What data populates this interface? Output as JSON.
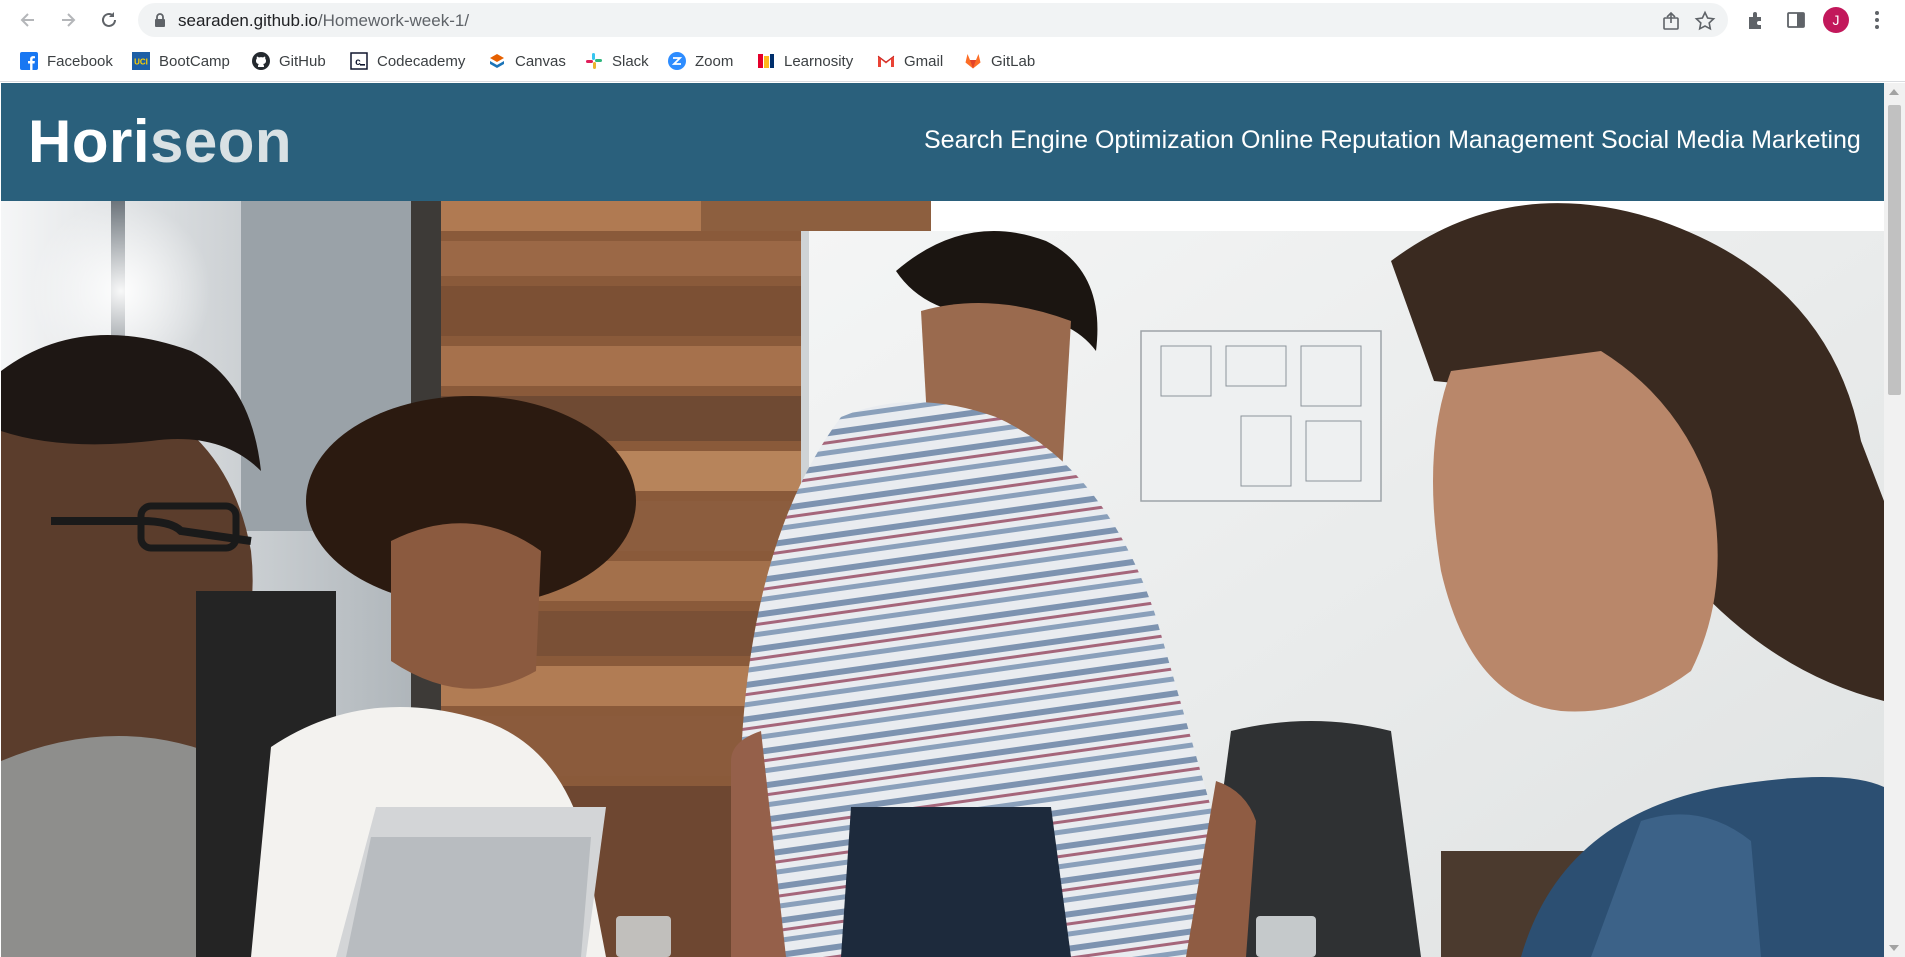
{
  "browser": {
    "url_host": "searaden.github.io",
    "url_path": "/Homework-week-1/",
    "profile_initial": "J",
    "profile_color": "#c2185b",
    "bookmarks": [
      {
        "label": "Facebook",
        "icon": "facebook-icon"
      },
      {
        "label": "BootCamp",
        "icon": "uci-icon"
      },
      {
        "label": "GitHub",
        "icon": "github-icon"
      },
      {
        "label": "Codecademy",
        "icon": "codecademy-icon"
      },
      {
        "label": "Canvas",
        "icon": "canvas-icon"
      },
      {
        "label": "Slack",
        "icon": "slack-icon"
      },
      {
        "label": "Zoom",
        "icon": "zoom-icon"
      },
      {
        "label": "Learnosity",
        "icon": "learnosity-icon"
      },
      {
        "label": "Gmail",
        "icon": "gmail-icon"
      },
      {
        "label": "GitLab",
        "icon": "gitlab-icon"
      }
    ]
  },
  "site": {
    "logo_main": "Hori",
    "logo_accent": "seon",
    "header_color": "#2a607c",
    "nav": [
      {
        "label": "Search Engine Optimization"
      },
      {
        "label": "Online Reputation Management"
      },
      {
        "label": "Social Media Marketing"
      }
    ],
    "hero": {
      "icon": "team-meeting-photo"
    }
  }
}
